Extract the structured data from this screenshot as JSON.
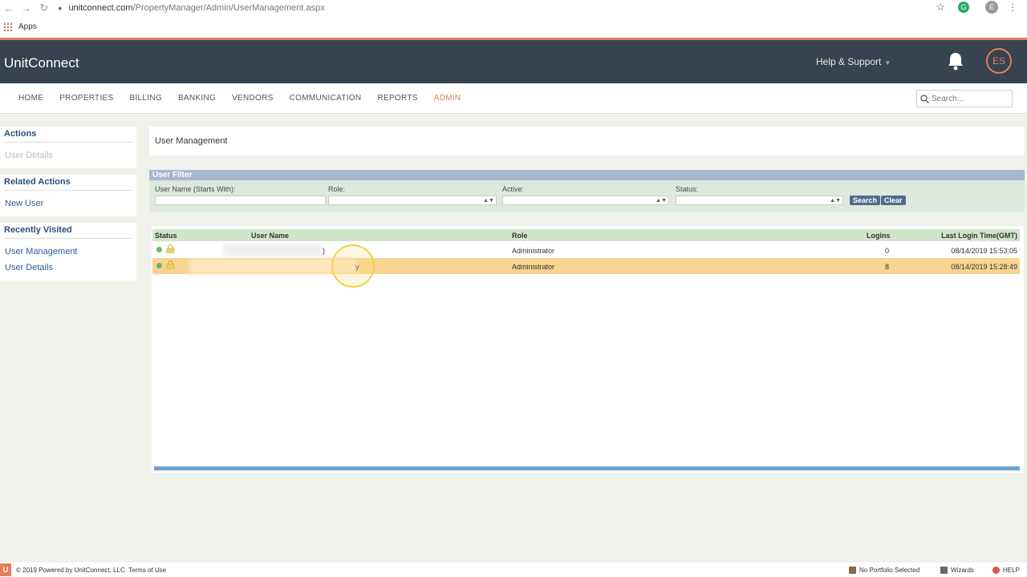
{
  "browser": {
    "url_host": "unitconnect.com",
    "url_path": "/PropertyManager/Admin/UserManagement.aspx",
    "bookmark_apps": "Apps",
    "profile_initial": "E"
  },
  "header": {
    "brand": "UnitConnect",
    "help_label": "Help & Support",
    "avatar_initials": "ES"
  },
  "nav": {
    "items": [
      "HOME",
      "PROPERTIES",
      "BILLING",
      "BANKING",
      "VENDORS",
      "COMMUNICATION",
      "REPORTS",
      "ADMIN"
    ],
    "active": "ADMIN",
    "search_placeholder": "Search..."
  },
  "sidebar": {
    "actions_title": "Actions",
    "actions_items": [
      "User Details"
    ],
    "related_title": "Related Actions",
    "related_items": [
      "New User"
    ],
    "recent_title": "Recently Visited",
    "recent_items": [
      "User Management",
      "User Details"
    ]
  },
  "main": {
    "title": "User Management"
  },
  "filter": {
    "title": "User Filter",
    "username_label": "User Name (Starts With):",
    "role_label": "Role:",
    "active_label": "Active:",
    "status_label": "Status:",
    "search_button": "Search",
    "clear_button": "Clear"
  },
  "grid": {
    "columns": [
      "Status",
      "User Name",
      "Role",
      "Logins",
      "Last Login Time(GMT)"
    ],
    "rows": [
      {
        "role": "Administrator",
        "logins": "0",
        "last_login": "08/14/2019 15:53:05",
        "username_tail": ")"
      },
      {
        "role": "Administrator",
        "logins": "8",
        "last_login": "08/14/2019 15:28:49",
        "username_tail": "y"
      }
    ]
  },
  "footer": {
    "copyright": "© 2019 Powered by UnitConnect, LLC.",
    "terms": "Terms of Use",
    "portfolio": "No Portfolio Selected",
    "wizards": "Wizards",
    "help": "HELP"
  },
  "colors": {
    "accent": "#e2815a",
    "header_bg": "#384250",
    "selected_row": "#f9d391",
    "grid_header": "#cfe6c9"
  }
}
